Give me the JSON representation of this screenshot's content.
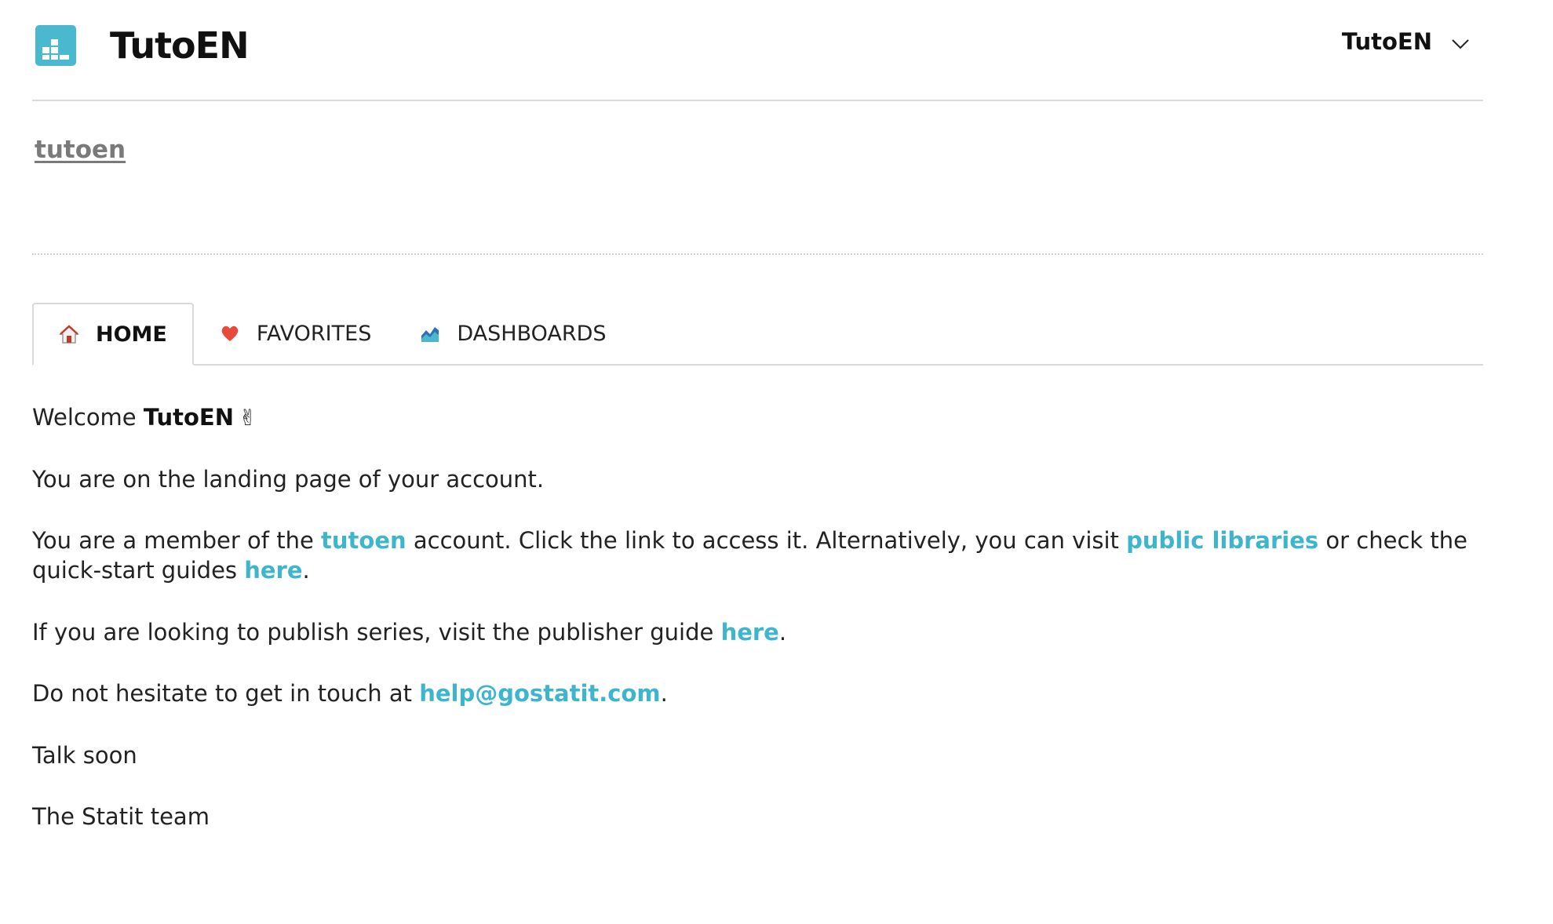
{
  "header": {
    "logo_label": "TutoEN",
    "account_menu": "TutoEN",
    "logo_icon": "bar-chart-logo-icon",
    "chevron_icon": "chevron-down-icon",
    "accent_color": "#4ab8cf"
  },
  "account": {
    "link_label": "tutoen"
  },
  "tabs": [
    {
      "label": "HOME",
      "icon": "house-icon",
      "active": true
    },
    {
      "label": "FAVORITES",
      "icon": "heart-icon",
      "active": false
    },
    {
      "label": "DASHBOARDS",
      "icon": "area-chart-icon",
      "active": false
    }
  ],
  "content": {
    "welcome_prefix": "Welcome ",
    "welcome_name": "TutoEN",
    "welcome_emoji": "✌",
    "landing_text": "You are on the landing page of your account.",
    "member_prefix": "You are a member of the ",
    "member_account_link": "tutoen",
    "member_mid": " account. Click the link to access it. Alternatively, you can visit ",
    "public_libraries_link": "public libraries",
    "member_mid2": " or check the quick-start guides ",
    "quickstart_link": "here",
    "member_suffix": ".",
    "publish_prefix": "If you are looking to publish series, visit the publisher guide ",
    "publish_link": "here",
    "publish_suffix": ".",
    "contact_prefix": "Do not hesitate to get in touch at ",
    "contact_email": "help@gostatit.com",
    "contact_suffix": ".",
    "talk_soon": "Talk soon",
    "signature": "The Statit team"
  },
  "colors": {
    "link": "#3db5cc",
    "heart": "#e8493b",
    "border": "#d9d9d9"
  }
}
